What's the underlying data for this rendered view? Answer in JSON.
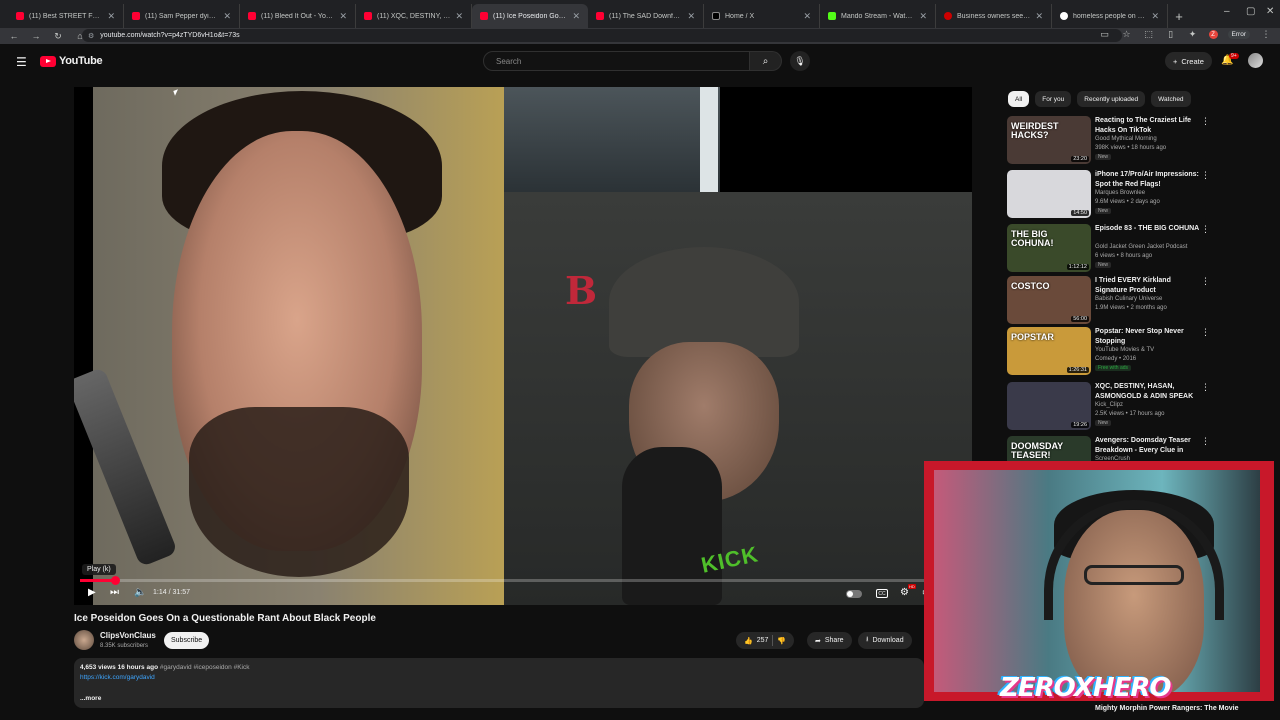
{
  "browser": {
    "tabs": [
      {
        "label": "(11) Best STREET FOOD in Me...",
        "icon": "youtube-icon",
        "active": false
      },
      {
        "label": "(11) Sam Pepper dying on the...",
        "icon": "youtube-icon",
        "active": false
      },
      {
        "label": "(11) Bleed It Out - YouTube",
        "icon": "youtube-icon",
        "active": false
      },
      {
        "label": "(11) XQC, DESTINY, HASAN, A...",
        "icon": "youtube-icon",
        "active": false
      },
      {
        "label": "(11) Ice Poseidon Goes On a Q...",
        "icon": "youtube-icon",
        "active": true
      },
      {
        "label": "(11) The SAD Downfall of Justi...",
        "icon": "youtube-icon",
        "active": false
      },
      {
        "label": "Home / X",
        "icon": "x-icon",
        "active": false
      },
      {
        "label": "Mando Stream - Watch Live o...",
        "icon": "kick-icon",
        "active": false
      },
      {
        "label": "Business owners seek from re...",
        "icon": "news-icon",
        "active": false
      },
      {
        "label": "homeless people on streets li...",
        "icon": "google-icon",
        "active": false
      }
    ],
    "url": "youtube.com/watch?v=p4zTYD6vH1o&t=73s",
    "profile_letter": "Z",
    "error_label": "Error"
  },
  "masthead": {
    "logo_text": "YouTube",
    "search_placeholder": "Search",
    "create_label": "Create",
    "notification_count": "9+"
  },
  "player": {
    "tooltip": "Play (k)",
    "time": "1:14 / 31:57",
    "progress_fraction": 0.039,
    "hd_label": "HD",
    "cc_label": "CC",
    "cap_letter": "B",
    "kick_text": "KICK"
  },
  "video": {
    "title": "Ice Poseidon Goes On a Questionable Rant About Black People",
    "channel": "ClipsVonClaus",
    "subscribers": "8.35K subscribers",
    "subscribe_label": "Subscribe",
    "likes": "257",
    "share_label": "Share",
    "download_label": "Download",
    "views_time": "4,653 views  16 hours ago",
    "hashtags": "#garydavid #iceposeidon #Kick",
    "link": "https://kick.com/garydavid",
    "more_label": "...more"
  },
  "sidebar": {
    "chips": [
      {
        "label": "All",
        "active": true
      },
      {
        "label": "For you",
        "active": false
      },
      {
        "label": "Recently uploaded",
        "active": false
      },
      {
        "label": "Watched",
        "active": false
      }
    ],
    "recommendations": [
      {
        "title": "Reacting to The Craziest Life Hacks On TikTok",
        "channel": "Good Mythical Morning",
        "meta": "398K views • 18 hours ago",
        "badge": "New",
        "duration": "23:20",
        "thumb_text": "WEIRDEST HACKS?",
        "thumb_color": "#4a3a35"
      },
      {
        "title": "iPhone 17/Pro/Air Impressions: Spot the Red Flags!",
        "channel": "Marques Brownlee",
        "meta": "9.6M views • 2 days ago",
        "badge": "New",
        "duration": "14:50",
        "thumb_text": "",
        "thumb_color": "#d8d8dc"
      },
      {
        "title": "Episode 83 - THE BIG COHUNA",
        "channel": "Gold Jacket Green Jacket Podcast",
        "meta": "6 views • 8 hours ago",
        "badge": "New",
        "duration": "1:12:12",
        "thumb_text": "THE BIG COHUNA!",
        "thumb_color": "#3a4a2a"
      },
      {
        "title": "I Tried EVERY Kirkland Signature Product",
        "channel": "Babish Culinary Universe",
        "meta": "1.9M views • 2 months ago",
        "badge": "",
        "duration": "56:00",
        "thumb_text": "COSTCO",
        "thumb_color": "#6a4a3a"
      },
      {
        "title": "Popstar: Never Stop Never Stopping",
        "channel": "YouTube Movies & TV",
        "meta": "Comedy • 2016",
        "badge": "Free with ads",
        "duration": "1:26:31",
        "thumb_text": "POPSTAR",
        "thumb_color": "#c99a3a"
      },
      {
        "title": "XQC, DESTINY, HASAN, ASMONGOLD & ADIN SPEAK ...",
        "channel": "Kick_Clipz",
        "meta": "2.5K views • 17 hours ago",
        "badge": "New",
        "duration": "19:26",
        "thumb_text": "",
        "thumb_color": "#3a3a4a"
      },
      {
        "title": "Avengers: Doomsday Teaser Breakdown - Every Clue in the...",
        "channel": "ScreenCrush",
        "meta": "",
        "badge": "",
        "duration": "",
        "thumb_text": "DOOMSDAY TEASER!",
        "thumb_color": "#2a3a2a"
      }
    ],
    "hidden_title": "Mighty Morphin Power Rangers: The Movie"
  },
  "overlay": {
    "brand_text": "ZEROXHERO"
  }
}
